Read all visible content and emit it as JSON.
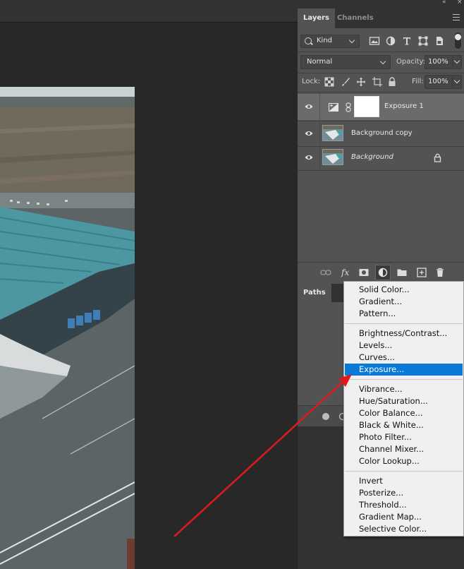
{
  "panel": {
    "tabs": [
      {
        "label": "Layers",
        "active": true
      },
      {
        "label": "Channels",
        "active": false
      }
    ],
    "filter": {
      "kind_label": "Kind",
      "icons": [
        "image-filter-icon",
        "adjustment-filter-icon",
        "type-filter-icon",
        "shape-filter-icon",
        "smart-object-filter-icon"
      ]
    },
    "blend_mode": "Normal",
    "opacity": {
      "label": "Opacity:",
      "value": "100%"
    },
    "lock": {
      "label": "Lock:",
      "icons": [
        "lock-transparent-icon",
        "lock-image-icon",
        "lock-position-icon",
        "lock-artboard-icon",
        "lock-all-icon"
      ]
    },
    "fill": {
      "label": "Fill:",
      "value": "100%"
    },
    "layers": [
      {
        "name": "Exposure 1",
        "type": "adjustment",
        "visible": true,
        "selected": true,
        "italic": false,
        "locked": false
      },
      {
        "name": "Background copy",
        "type": "image",
        "visible": true,
        "selected": false,
        "italic": false,
        "locked": false
      },
      {
        "name": "Background",
        "type": "image",
        "visible": true,
        "selected": false,
        "italic": true,
        "locked": true
      }
    ],
    "footer_icons": [
      "link-layers-icon",
      "fx-icon",
      "add-mask-icon",
      "adjustment-layer-icon",
      "group-folder-icon",
      "new-layer-icon",
      "delete-layer-icon"
    ]
  },
  "paths_panel": {
    "tab_label": "Paths"
  },
  "adjustment_menu": {
    "groups": [
      [
        "Solid Color...",
        "Gradient...",
        "Pattern..."
      ],
      [
        "Brightness/Contrast...",
        "Levels...",
        "Curves...",
        "Exposure..."
      ],
      [
        "Vibrance...",
        "Hue/Saturation...",
        "Color Balance...",
        "Black & White...",
        "Photo Filter...",
        "Channel Mixer...",
        "Color Lookup..."
      ],
      [
        "Invert",
        "Posterize...",
        "Threshold...",
        "Gradient Map...",
        "Selective Color..."
      ]
    ],
    "highlighted": "Exposure..."
  },
  "colors": {
    "panel_bg": "#535353",
    "tab_bar": "#323232",
    "selected_layer": "#6b6b6b",
    "menu_bg": "#f0f0f0",
    "menu_highlight": "#0a78d7",
    "annotation_arrow": "#e01a1a"
  }
}
